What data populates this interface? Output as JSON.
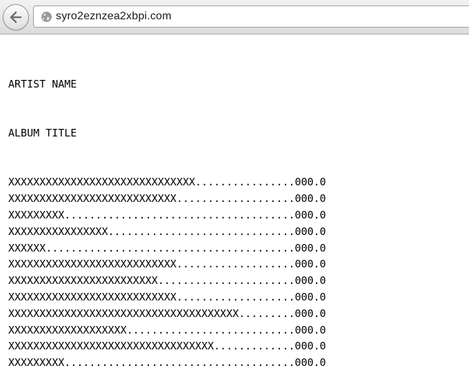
{
  "browser": {
    "url": "syro2eznzea2xbpi.com"
  },
  "page": {
    "artist": "ARTIST NAME",
    "album": "ALBUM TITLE",
    "tracks": [
      {
        "title": "XXXXXXXXXXXXXXXXXXXXXXXXXXXXXX",
        "duration": "000.0"
      },
      {
        "title": "XXXXXXXXXXXXXXXXXXXXXXXXXXX",
        "duration": "000.0"
      },
      {
        "title": "XXXXXXXXX",
        "duration": "000.0"
      },
      {
        "title": "XXXXXXXXXXXXXXXX",
        "duration": "000.0"
      },
      {
        "title": "XXXXXX",
        "duration": "000.0"
      },
      {
        "title": "XXXXXXXXXXXXXXXXXXXXXXXXXXX",
        "duration": "000.0"
      },
      {
        "title": "XXXXXXXXXXXXXXXXXXXXXXXX",
        "duration": "000.0"
      },
      {
        "title": "XXXXXXXXXXXXXXXXXXXXXXXXXXX",
        "duration": "000.0"
      },
      {
        "title": "XXXXXXXXXXXXXXXXXXXXXXXXXXXXXXXXXXXXX",
        "duration": "000.0"
      },
      {
        "title": "XXXXXXXXXXXXXXXXXXX",
        "duration": "000.0"
      },
      {
        "title": "XXXXXXXXXXXXXXXXXXXXXXXXXXXXXXXXX",
        "duration": "000.0"
      },
      {
        "title": "XXXXXXXXX",
        "duration": "000.0"
      }
    ]
  }
}
